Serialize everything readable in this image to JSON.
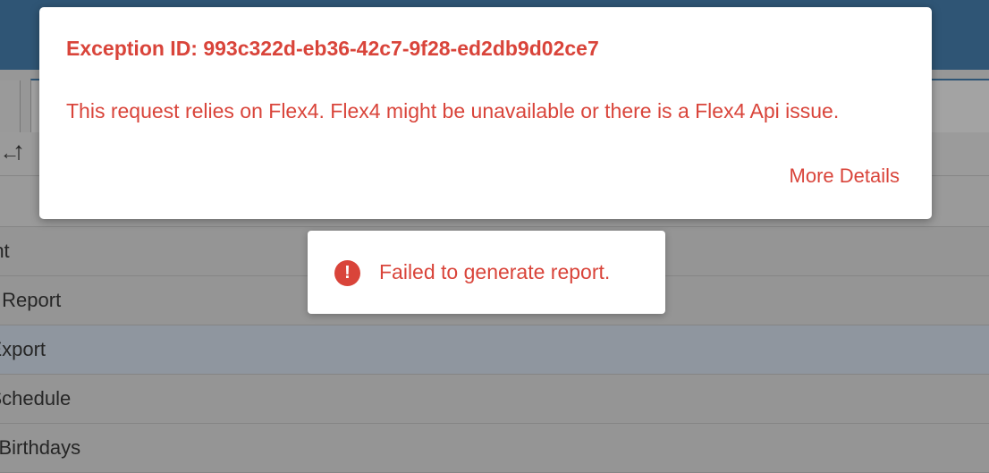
{
  "modal": {
    "title": "Exception ID: 993c322d-eb36-42c7-9f28-ed2db9d02ce7",
    "message": "This request relies on Flex4. Flex4 might be unavailable or there is a Flex4 Api issue.",
    "link_label": "More Details",
    "color": "#d9443a"
  },
  "toast": {
    "icon": "exclamation-icon",
    "icon_glyph": "!",
    "message": "Failed to generate report."
  },
  "toolbar": {
    "left_arrow_icon": "arrow-left-icon",
    "left_arrow_glyph": "←",
    "up_arrow_icon": "arrow-up-icon",
    "up_arrow_glyph": "↑"
  },
  "reports": [
    {
      "label": "r Print",
      "selected": false
    },
    {
      "label": "ndar Report",
      "selected": false
    },
    {
      "label": "act Export",
      "selected": true
    },
    {
      "label": "act Schedule",
      "selected": false
    },
    {
      "label": "acts Birthdays",
      "selected": false
    }
  ],
  "colors": {
    "topbar": "#2f5575",
    "error": "#d9443a"
  }
}
